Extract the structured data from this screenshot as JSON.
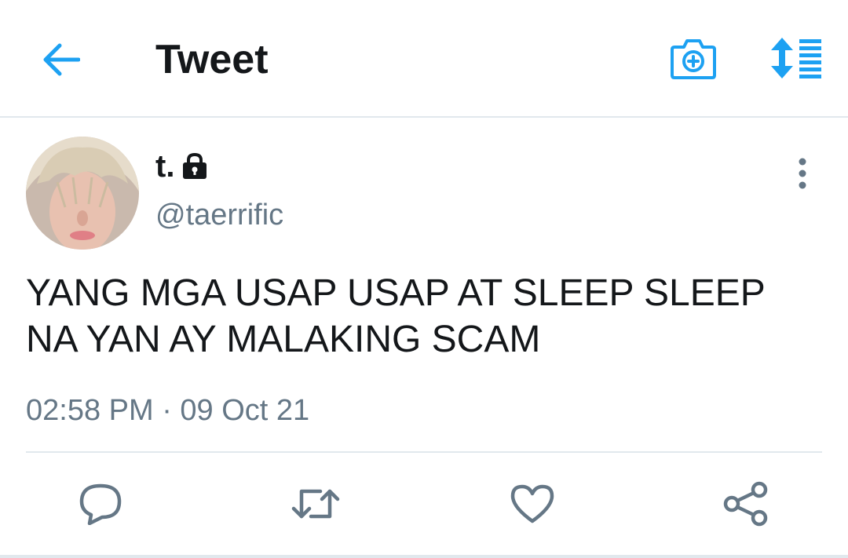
{
  "header": {
    "title": "Tweet",
    "back_icon": "arrow-left-icon",
    "camera_icon": "camera-plus-icon",
    "sort_icon": "sort-list-icon"
  },
  "tweet": {
    "display_name": "t.",
    "protected_icon": "lock-icon",
    "handle": "@taerrific",
    "text_line1": "YANG MGA USAP USAP AT SLEEP SLEEP",
    "text_line2": "NA YAN AY MALAKING SCAM",
    "timestamp": "02:58 PM · 09 Oct 21"
  },
  "actions": {
    "reply_icon": "reply-icon",
    "retweet_icon": "retweet-icon",
    "like_icon": "heart-icon",
    "share_icon": "share-icon"
  },
  "colors": {
    "accent": "#1da1f2",
    "text_primary": "#14171a",
    "text_secondary": "#657786",
    "divider": "#e1e8ed"
  }
}
